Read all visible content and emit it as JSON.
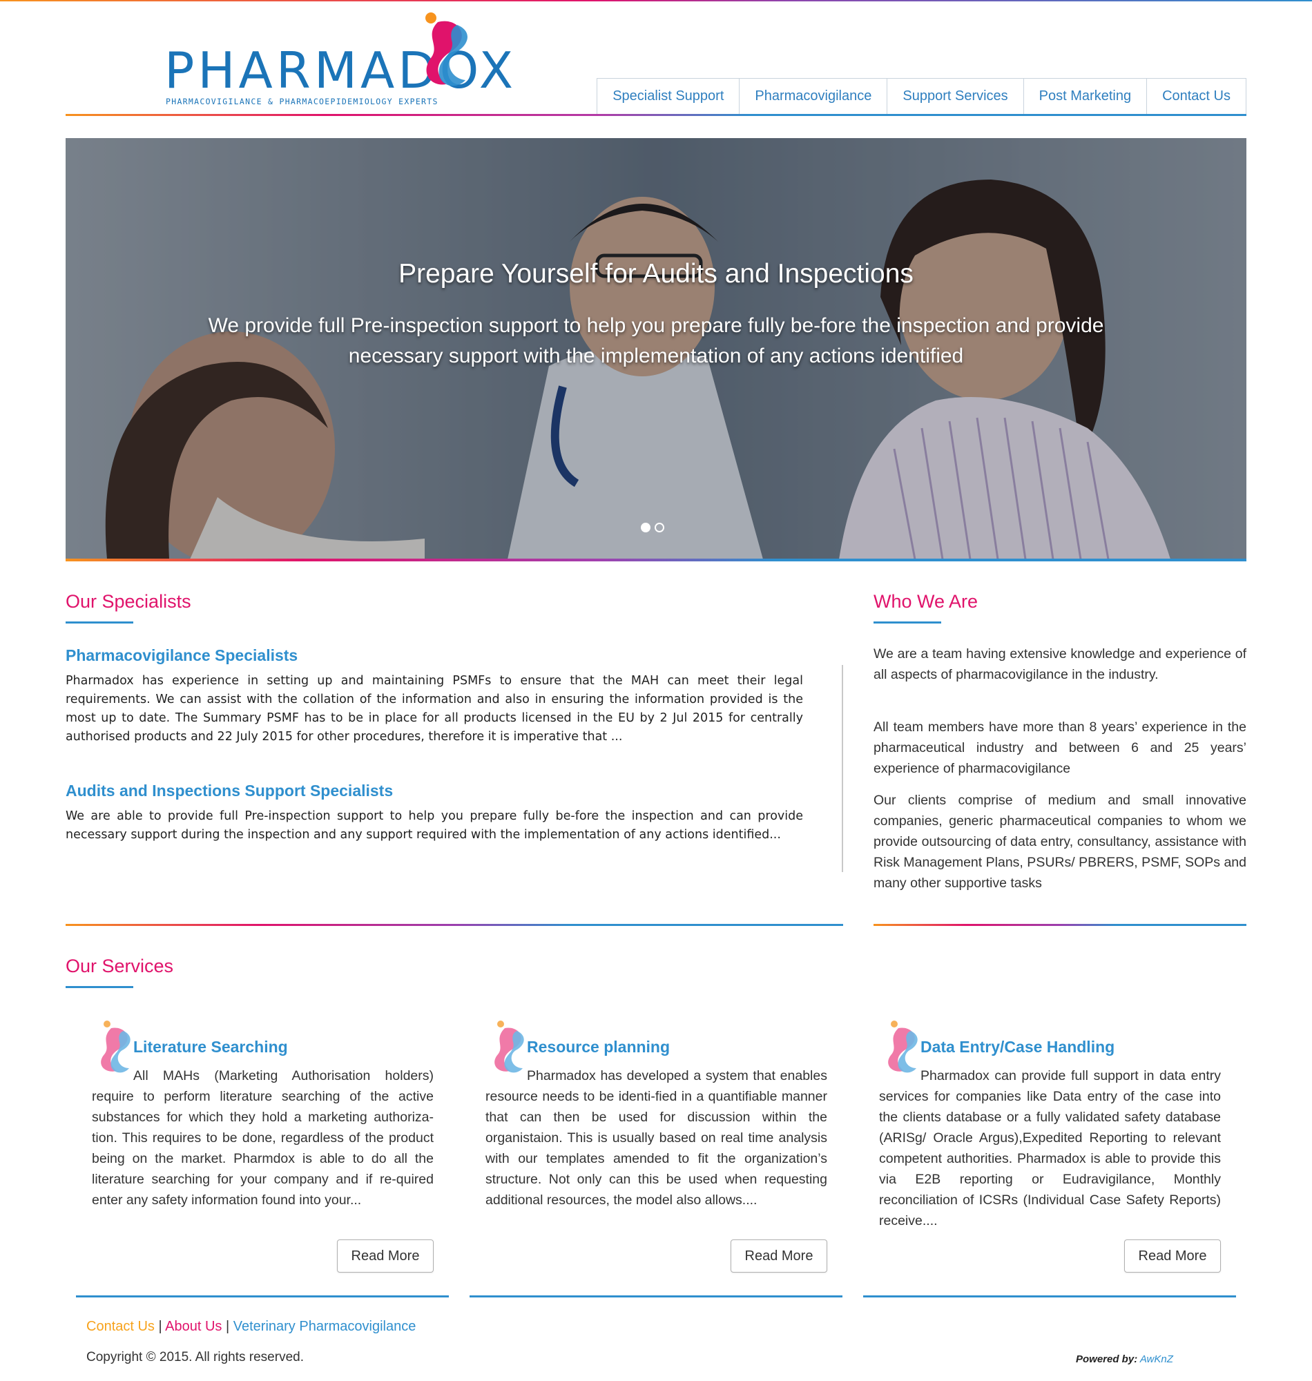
{
  "header": {
    "logo_text": "PHARMADOX",
    "logo_tagline": "PHARMACOVIGILANCE & PHARMACOEPIDEMIOLOGY EXPERTS",
    "nav": [
      {
        "label": "Specialist Support"
      },
      {
        "label": "Pharmacovigilance"
      },
      {
        "label": "Support Services"
      },
      {
        "label": "Post Marketing"
      },
      {
        "label": "Contact Us"
      }
    ]
  },
  "hero": {
    "title": "Prepare Yourself for Audits and Inspections",
    "text": "We provide full Pre-inspection support to help you prepare fully be-fore the inspection and provide necessary support with the implementation of any actions identified",
    "slides_total": 2,
    "active_slide": 1
  },
  "specialists": {
    "heading": "Our Specialists",
    "items": [
      {
        "title": "Pharmacovigilance Specialists",
        "text": "Pharmadox has experience in setting up and maintaining PSMFs to ensure that the MAH can meet their legal requirements. We can assist with the collation of the information and also in ensuring the information provided is the most up to date. The Summary PSMF has to be in place for all products licensed in the EU by 2 Jul 2015 for centrally authorised products and 22 July 2015 for other procedures, therefore it is imperative that ..."
      },
      {
        "title": "Audits and Inspections Support Specialists",
        "text": "We are able to provide full Pre-inspection support to help you prepare fully be-fore the inspection and can provide necessary support during the inspection and any support required with the implementation of any actions identified..."
      }
    ]
  },
  "who": {
    "heading": "Who We Are",
    "paragraphs": [
      "We are a team having extensive knowledge and experience of all aspects of pharmacovigilance in the industry.",
      "All team members have more than 8 years’ experience in the pharmaceutical industry and between 6 and 25 years’ experience of pharmacovigilance",
      "Our clients comprise of medium and small innovative companies, generic pharmaceutical companies to whom we provide outsourcing of data entry, consultancy, assistance with Risk Management Plans, PSURs/ PBRERS, PSMF, SOPs and many other supportive tasks"
    ]
  },
  "services": {
    "heading": "Our Services",
    "items": [
      {
        "title": "Literature Searching",
        "text": "All MAHs (Marketing Authorisation holders) require to perform literature searching of the active substances for which they hold a marketing authoriza-tion. This requires to be done, regardless of the product being on the market. Pharmdox is able to do all the literature searching for your company and if re-quired enter any safety information found into your...",
        "button": "Read More"
      },
      {
        "title": "Resource planning",
        "text": "Pharmadox has developed a system that enables resource needs to be identi-fied in a quantifiable manner that can then be used for discussion within the organistaion. This is usually based on real time analysis with our templates amended to fit the organization’s structure. Not only can this be used when requesting additional resources, the model also allows....",
        "button": "Read More"
      },
      {
        "title": "Data Entry/Case Handling",
        "text": "Pharmadox can provide full support in data entry services for companies like Data entry of the case into the clients database or a fully validated safety database (ARISg/ Oracle Argus),Expedited Reporting to relevant competent authorities. Pharmadox is able to provide this via E2B reporting or Eudravigilance, Monthly reconciliation of ICSRs (Individual Case Safety Reports) receive....",
        "button": "Read More"
      }
    ]
  },
  "footer": {
    "links": [
      {
        "label": "Contact Us",
        "color": "#f7a21b"
      },
      {
        "label": "About Us",
        "color": "#e0136b"
      },
      {
        "label": "Veterinary Pharmacovigilance",
        "color": "#2f8fce"
      }
    ],
    "separator": "|",
    "copyright": "Copyright © 2015. All rights reserved.",
    "powered_label": "Powered by:",
    "powered_by": "AwKnZ"
  },
  "colors": {
    "brand_blue": "#1b74b8",
    "accent_blue": "#2f8fce",
    "accent_pink": "#e0136b",
    "accent_orange": "#f7931e"
  },
  "icons": [
    "pharmadox-logo-mark",
    "service-bullet-icon"
  ]
}
